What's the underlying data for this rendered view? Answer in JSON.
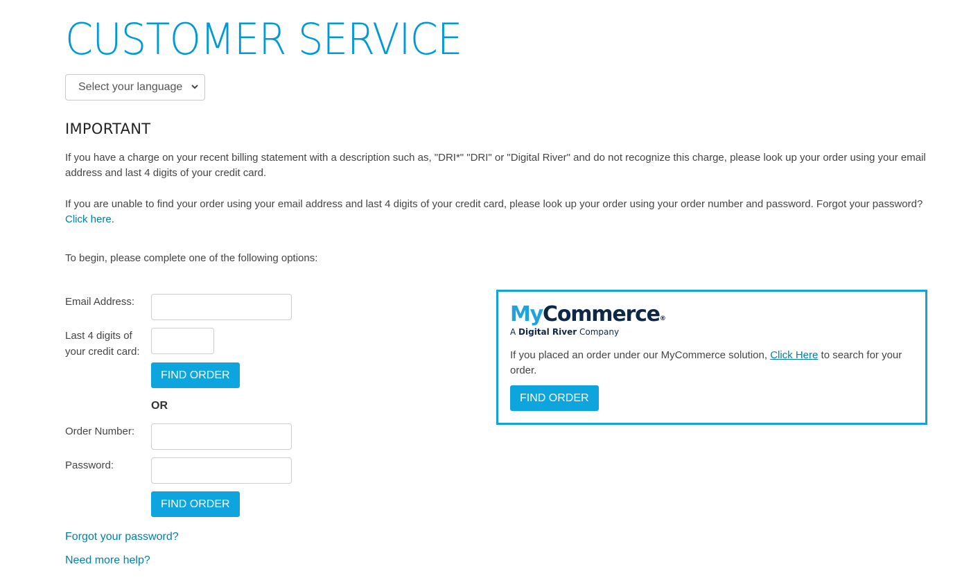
{
  "header": {
    "title": "CUSTOMER SERVICE",
    "language_select": {
      "selected": "Select your language"
    }
  },
  "important": {
    "heading": "IMPORTANT",
    "paragraph1": "If you have a charge on your recent billing statement with a description such as, \"DRI*\" \"DRI\" or \"Digital River\" and do not recognize this charge, please look up your order using your email address and last 4 digits of your credit card.",
    "paragraph2_text": "If you are unable to find your order using your email address and last 4 digits of your credit card, please look up your order using your order number and password. Forgot your password? ",
    "paragraph2_link": "Click here",
    "paragraph2_after": ".",
    "instructions": "To begin, please complete one of the following options:"
  },
  "form_email": {
    "email_label": "Email Address:",
    "email_value": "",
    "card_label_line1": "Last 4 digits of",
    "card_label_line2": "your credit card:",
    "card_value": "",
    "submit_label": "FIND ORDER"
  },
  "separator": "OR",
  "form_order": {
    "order_label": "Order Number:",
    "order_value": "",
    "password_label": "Password:",
    "password_value": "",
    "submit_label": "FIND ORDER"
  },
  "links": {
    "forgot_password": "Forgot your password?",
    "need_help": "Need more help?"
  },
  "mycommerce": {
    "brand_my": "My",
    "brand_commerce": "Commerce",
    "registered": "®",
    "tagline_pre": "A ",
    "tagline_bold": "Digital River",
    "tagline_post": " Company",
    "text_before": "If you placed an order under our MyCommerce solution, ",
    "link": "Click Here",
    "text_after": " to search for your order.",
    "button_label": "FIND ORDER"
  },
  "colors": {
    "accent": "#0099d8",
    "button": "#0ea4de",
    "link": "#007fa8",
    "box_border": "#16a2d4",
    "brand_navy": "#0f2747"
  }
}
